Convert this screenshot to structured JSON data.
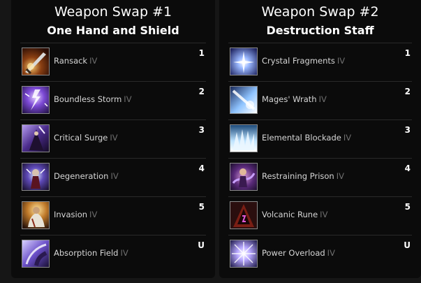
{
  "panels": [
    {
      "title": "Weapon Swap #1",
      "subtitle": "One Hand and Shield",
      "skills": [
        {
          "name": "Ransack",
          "rank": "IV",
          "slot": "1",
          "icon": "ransack-icon"
        },
        {
          "name": "Boundless Storm",
          "rank": "IV",
          "slot": "2",
          "icon": "boundless-storm-icon"
        },
        {
          "name": "Critical Surge",
          "rank": "IV",
          "slot": "3",
          "icon": "critical-surge-icon"
        },
        {
          "name": "Degeneration",
          "rank": "IV",
          "slot": "4",
          "icon": "degeneration-icon"
        },
        {
          "name": "Invasion",
          "rank": "IV",
          "slot": "5",
          "icon": "invasion-icon"
        },
        {
          "name": "Absorption Field",
          "rank": "IV",
          "slot": "U",
          "icon": "absorption-field-icon"
        }
      ]
    },
    {
      "title": "Weapon Swap #2",
      "subtitle": "Destruction Staff",
      "skills": [
        {
          "name": "Crystal Fragments",
          "rank": "IV",
          "slot": "1",
          "icon": "crystal-fragments-icon"
        },
        {
          "name": "Mages' Wrath",
          "rank": "IV",
          "slot": "2",
          "icon": "mages-wrath-icon"
        },
        {
          "name": "Elemental Blockade",
          "rank": "IV",
          "slot": "3",
          "icon": "elemental-blockade-icon"
        },
        {
          "name": "Restraining Prison",
          "rank": "IV",
          "slot": "4",
          "icon": "restraining-prison-icon"
        },
        {
          "name": "Volcanic Rune",
          "rank": "IV",
          "slot": "5",
          "icon": "volcanic-rune-icon"
        },
        {
          "name": "Power Overload",
          "rank": "IV",
          "slot": "U",
          "icon": "power-overload-icon"
        }
      ]
    }
  ],
  "colors": {
    "page_background": "#161616",
    "panel_background": "#0b0b0b",
    "title_text": "#ffffff",
    "skill_name_text": "#d6d6d6",
    "rank_text": "#6f6f6f",
    "row_divider": "#2a2a2a"
  }
}
